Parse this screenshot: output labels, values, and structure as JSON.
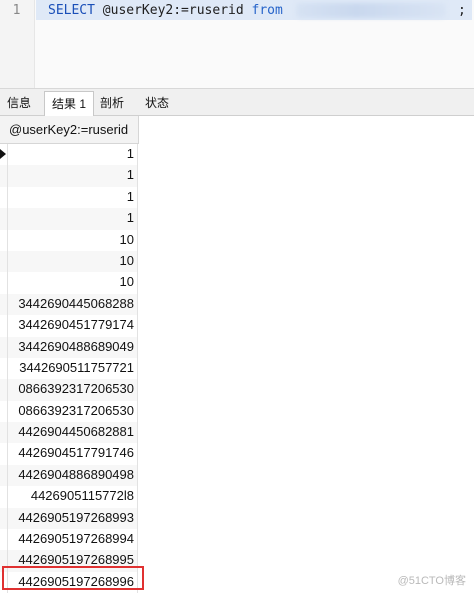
{
  "editor": {
    "line_number": "1",
    "code_select": "SELECT",
    "code_expr": " @userKey2:=ruserid ",
    "code_from": "from",
    "code_end": ";"
  },
  "tabs": [
    {
      "label": "信息"
    },
    {
      "label": "结果 1"
    },
    {
      "label": "剖析"
    },
    {
      "label": "状态"
    }
  ],
  "grid": {
    "column_header": "@userKey2:=ruserid",
    "rows": [
      "1",
      "1",
      "1",
      "1",
      "10",
      "10",
      "10",
      "3442690445068288",
      "3442690451779174",
      "3442690488689049",
      "3442690511757721",
      "0866392317206530",
      "0866392317206530",
      "4426904450682881",
      "4426904517791746",
      "4426904886890498",
      "4426905115772l8",
      "4426905197268993",
      "4426905197268994",
      "4426905197268995",
      "4426905197268996"
    ]
  },
  "watermark": "@51CTO博客"
}
